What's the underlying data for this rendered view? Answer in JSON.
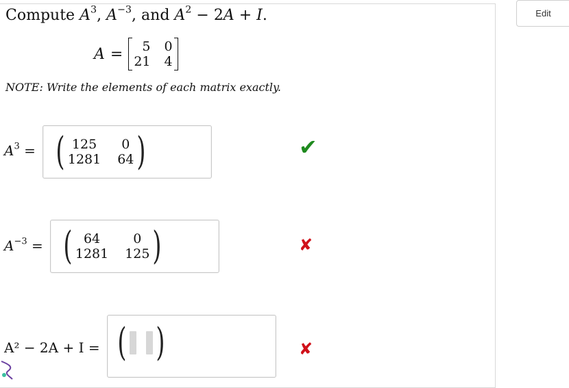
{
  "question": {
    "compute_word": "Compute",
    "and_word": "and",
    "period": "."
  },
  "definition": {
    "lhs": "A",
    "eq": "=",
    "matrix": [
      "5",
      "0",
      "21",
      "4"
    ]
  },
  "note": "NOTE: Write the elements of each matrix exactly.",
  "answers": [
    {
      "lhs_sup": "3",
      "matrix": [
        "125",
        "0",
        "1281",
        "64"
      ],
      "status": "correct"
    },
    {
      "lhs_sup": "−3",
      "matrix": [
        "64",
        "0",
        "1281",
        "125"
      ],
      "status": "incorrect"
    },
    {
      "lhs_text": "A² − 2A + I =",
      "matrix": [],
      "status": "incorrect"
    }
  ],
  "edit_button": "Edit",
  "status_icons": {
    "correct": "✔",
    "incorrect": "✘"
  },
  "colors": {
    "correct": "#1f8a1f",
    "incorrect": "#d0111a"
  }
}
